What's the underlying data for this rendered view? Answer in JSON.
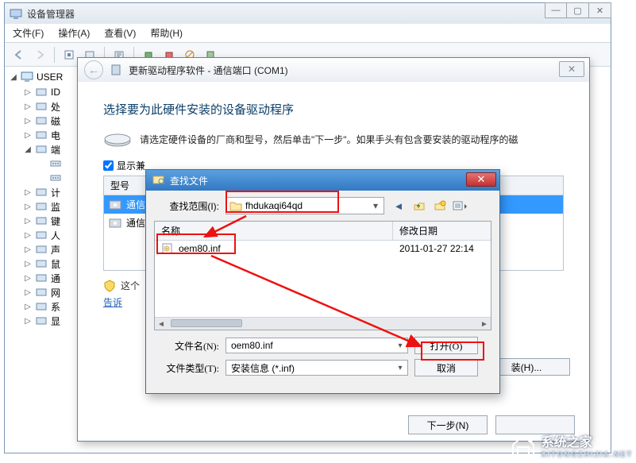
{
  "outer": {
    "title": "设备管理器",
    "menu": {
      "file": "文件(F)",
      "action": "操作(A)",
      "view": "查看(V)",
      "help": "帮助(H)"
    },
    "winbtns": {
      "min": "—",
      "max": "▢",
      "close": "✕"
    }
  },
  "tree": {
    "root": "USER",
    "items": [
      {
        "expander": "▷",
        "label": "ID"
      },
      {
        "expander": "▷",
        "label": "处"
      },
      {
        "expander": "▷",
        "label": "磁"
      },
      {
        "expander": "▷",
        "label": "电"
      },
      {
        "expander": "◢",
        "label": "端",
        "children": [
          "",
          ""
        ]
      },
      {
        "expander": "▷",
        "label": "计"
      },
      {
        "expander": "▷",
        "label": "监"
      },
      {
        "expander": "▷",
        "label": "键"
      },
      {
        "expander": "▷",
        "label": "人"
      },
      {
        "expander": "▷",
        "label": "声"
      },
      {
        "expander": "▷",
        "label": "鼠"
      },
      {
        "expander": "▷",
        "label": "通"
      },
      {
        "expander": "▷",
        "label": "网"
      },
      {
        "expander": "▷",
        "label": "系"
      },
      {
        "expander": "▷",
        "label": "显"
      }
    ]
  },
  "wizard": {
    "back": "←",
    "title": "更新驱动程序软件 - 通信端口 (COM1)",
    "close": "✕",
    "heading": "选择要为此硬件安装的设备驱动程序",
    "instruction": "请选定硬件设备的厂商和型号，然后单击\"下一步\"。如果手头有包含要安装的驱动程序的磁",
    "show_compat_label": "显示兼",
    "model_header": "型号",
    "model_rows": [
      {
        "label": "通信",
        "selected": true
      },
      {
        "label": "通信",
        "selected": false
      }
    ],
    "cert_text": "这个",
    "tell_link": "告诉",
    "hd_btn": "装(H)...",
    "next_btn": "下一步(N)",
    "cancel_btn": ""
  },
  "filedlg": {
    "title": "查找文件",
    "close": "✕",
    "lookin_label": "查找范围(I):",
    "lookin_value": "fhdukaqi64qd",
    "col_name": "名称",
    "col_date": "修改日期",
    "row_file": "oem80.inf",
    "row_date": "2011-01-27 22:14",
    "filename_label": "文件名(N):",
    "filename_value": "oem80.inf",
    "filetype_label": "文件类型(T):",
    "filetype_value": "安装信息 (*.inf)",
    "open_btn": "打开(O)",
    "cancel_btn": "取消"
  },
  "watermark": {
    "brand": "系统之家",
    "sub": "XITONGZHIJIA.NET"
  }
}
